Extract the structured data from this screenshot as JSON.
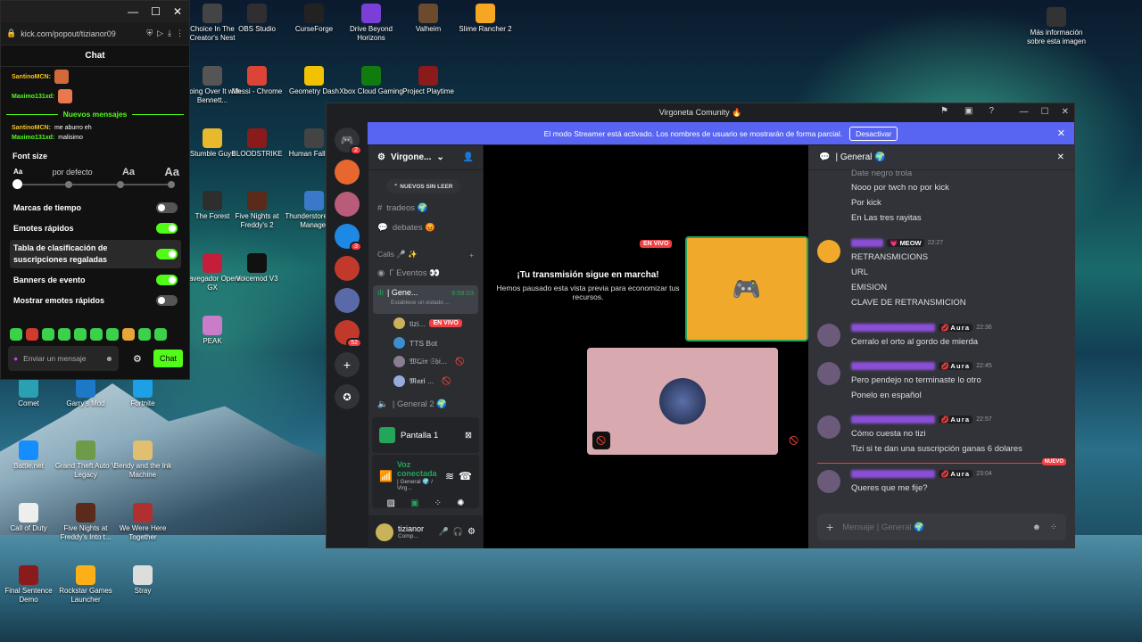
{
  "desktop": {
    "icons": [
      {
        "label": "Choice In The Creator's Nest",
        "color": "#444"
      },
      {
        "label": "OBS Studio",
        "color": "#302e31"
      },
      {
        "label": "CurseForge",
        "color": "#222"
      },
      {
        "label": "Drive Beyond Horizons",
        "color": "#7a3fd6"
      },
      {
        "label": "Valheim",
        "color": "#6b4a2e"
      },
      {
        "label": "Slime Rancher 2",
        "color": "#f5a623"
      },
      {
        "label": "Más información sobre esta imagen",
        "color": "#333"
      },
      {
        "label": "Going Over It with Bennett...",
        "color": "#555"
      },
      {
        "label": "Messi - Chrome",
        "color": "#db4437"
      },
      {
        "label": "Geometry Dash",
        "color": "#f2c200"
      },
      {
        "label": "Xbox Cloud Gaming",
        "color": "#107c10"
      },
      {
        "label": "Project Playtime",
        "color": "#8b1a1a"
      },
      {
        "label": "Stumble Guys",
        "color": "#e8b82d"
      },
      {
        "label": "BLOODSTRIKE",
        "color": "#8b1a1a"
      },
      {
        "label": "Human Fall Flat",
        "color": "#444"
      },
      {
        "label": "The Forest",
        "color": "#2e2e2e"
      },
      {
        "label": "Five Nights at Freddy's 2",
        "color": "#5a2a1a"
      },
      {
        "label": "Thunderstore Mod Manager",
        "color": "#3a79c9"
      },
      {
        "label": "Navegador Opera GX",
        "color": "#c41e3a"
      },
      {
        "label": "Voicemod V3",
        "color": "#111"
      },
      {
        "label": "PEAK",
        "color": "#c97cc7"
      },
      {
        "label": "Comet",
        "color": "#2aa1b3"
      },
      {
        "label": "Garry's Mod",
        "color": "#1e78c8"
      },
      {
        "label": "Fortnite",
        "color": "#1ea0e6"
      },
      {
        "label": "Battle.net",
        "color": "#148eff"
      },
      {
        "label": "Grand Theft Auto V Legacy",
        "color": "#6e9a4a"
      },
      {
        "label": "Bendy and the Ink Machine",
        "color": "#e0c070"
      },
      {
        "label": "Call of Duty",
        "color": "#eeeeee"
      },
      {
        "label": "Five Nights at Freddy's Into t...",
        "color": "#5a2a1a"
      },
      {
        "label": "We Were Here Together",
        "color": "#b03030"
      },
      {
        "label": "Final Sentence Demo",
        "color": "#8b1a1a"
      },
      {
        "label": "Rockstar Games Launcher",
        "color": "#fcaf17"
      },
      {
        "label": "Stray",
        "color": "#ddd"
      }
    ]
  },
  "kick": {
    "window_controls": [
      "—",
      "☐",
      "✕"
    ],
    "url": "kick.com/popout/tizianor09",
    "chat_title": "Chat",
    "messages": [
      {
        "user": "SantinoMCN:",
        "color": "#f5c518",
        "text": ""
      },
      {
        "user": "Maximo131xd:",
        "color": "#53fc18",
        "text": ""
      }
    ],
    "new_messages_label": "Nuevos mensajes",
    "messages_after": [
      {
        "user": "SantinoMCN:",
        "color": "#f5c518",
        "text": "me aburro eh"
      },
      {
        "user": "Maximo131xd:",
        "color": "#53fc18",
        "text": "malisimo"
      }
    ],
    "font_size": {
      "title": "Font size",
      "options": [
        "Aa",
        "por defecto",
        "Aa",
        "Aa"
      ],
      "selected_index": 0
    },
    "settings": [
      {
        "label": "Marcas de tiempo",
        "on": false
      },
      {
        "label": "Emotes rápidos",
        "on": true
      },
      {
        "label": "Tabla de clasificación de suscripciones regaladas",
        "on": true
      },
      {
        "label": "Banners de evento",
        "on": true
      },
      {
        "label": "Mostrar emotes rápidos",
        "on": false
      }
    ],
    "input_placeholder": "Enviar un mensaje",
    "chat_button": "Chat"
  },
  "discord": {
    "window_title": "Virgoneta Comunity 🔥",
    "banner_text": "El modo Streamer está activado. Los nombres de usuario se mostrarán de forma parcial.",
    "banner_button": "Desactivar",
    "server_name": "Virgone...",
    "guild_badges": [
      "2",
      "3",
      "52"
    ],
    "new_unread_pill": "NUEVOS SIN LEER",
    "channels": [
      {
        "name": "tradeos 🌍",
        "icon": "#"
      },
      {
        "name": "debates 😡",
        "icon": "💬"
      }
    ],
    "category": "Calls 🎤 ✨",
    "voice_channels": [
      {
        "name": "Γ Eventos 👀"
      },
      {
        "name": "| Gene...",
        "timer": "9:58:03",
        "status": "Establece un estado ..."
      }
    ],
    "voice_users": [
      {
        "name": "tizi...",
        "live": "EN VIVO"
      },
      {
        "name": "TTS Bot",
        "live": ""
      },
      {
        "name": "𝔚𝔔𝔦𝔫 𝔖𝔥𝔦...",
        "live": ""
      },
      {
        "name": "𝕸𝖆𝖝𝖎 ...",
        "live": ""
      }
    ],
    "voice_channel_2": "| General 2 🌍",
    "screen_panel": {
      "title": "Pantalla 1"
    },
    "voice_panel": {
      "status": "Voz conectada",
      "sub": "| General 🌍 / Virg..."
    },
    "user_panel": {
      "name": "tizianor",
      "status": "Comp..."
    },
    "stage": {
      "live_badge": "EN VIVO",
      "stream_title": "¡Tu transmisión sigue en marcha!",
      "stream_sub": "Hemos pausado esta vista previa para economizar tus recursos."
    },
    "chat": {
      "channel": "| General 🌍",
      "top_lines": [
        "Date negro trola",
        "Nooo por twch no por kick",
        "Por kick",
        "En Las tres rayitas"
      ],
      "messages": [
        {
          "tag": "💗 MEOW",
          "time": "22:27",
          "lines": [
            "RETRANSMICIONS",
            "URL",
            "EMISION",
            "CLAVE DE RETRANSMICION"
          ]
        },
        {
          "tag": "💋Aura",
          "time": "22:36",
          "lines": [
            "Cerralo el orto al gordo de mierda"
          ]
        },
        {
          "tag": "💋Aura",
          "time": "22:45",
          "lines": [
            "Pero pendejo no terminaste lo otro",
            "Ponelo en español"
          ]
        },
        {
          "tag": "💋Aura",
          "time": "22:57",
          "lines": [
            "Cómo cuesta no tizi",
            "Tizi si te dan una suscripción ganas 6 dolares"
          ]
        },
        {
          "tag": "💋Aura",
          "time": "23:04",
          "lines": [
            "Queres que me fije?"
          ]
        }
      ],
      "new_label": "NUEVO",
      "input_placeholder": "Mensaje | General 🌍"
    }
  }
}
